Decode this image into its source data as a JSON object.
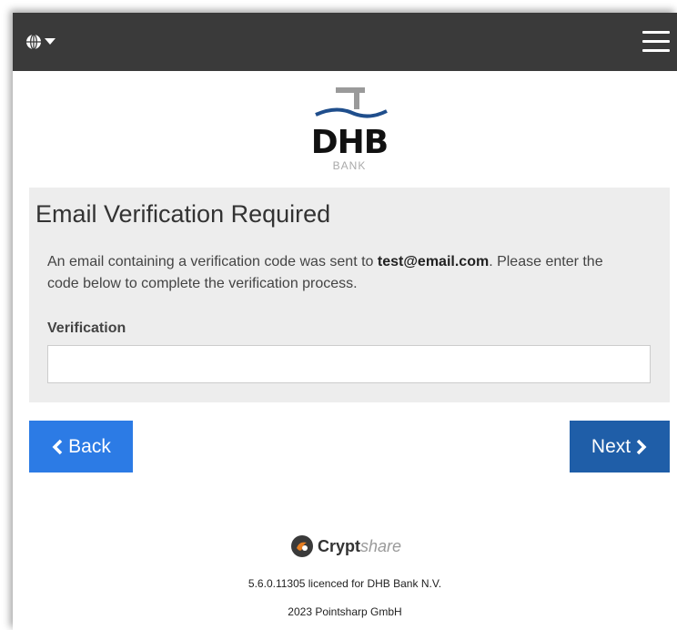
{
  "header": {
    "language_icon": "globe-icon",
    "dropdown_icon": "caret-down-icon",
    "menu_icon": "hamburger-menu-icon"
  },
  "logo": {
    "name": "DHB",
    "subtitle": "BANK"
  },
  "panel": {
    "title": "Email Verification Required",
    "description_before": "An email containing a verification code was sent to ",
    "email": "test@email.com",
    "description_after": ". Please enter the code below to complete the verification process.",
    "field_label": "Verification",
    "field_value": "",
    "field_placeholder": ""
  },
  "buttons": {
    "back_label": "Back",
    "next_label": "Next"
  },
  "footer": {
    "brand_bold": "Crypt",
    "brand_light": "share",
    "version_line": "5.6.0.11305 licenced for DHB Bank N.V.",
    "copyright_line": "2023 Pointsharp GmbH"
  },
  "colors": {
    "topbar": "#3a3a3a",
    "panel_bg": "#ededed",
    "back_button": "#2c7be5",
    "next_button": "#1f5ea8",
    "logo_blue": "#1f4e8c"
  }
}
